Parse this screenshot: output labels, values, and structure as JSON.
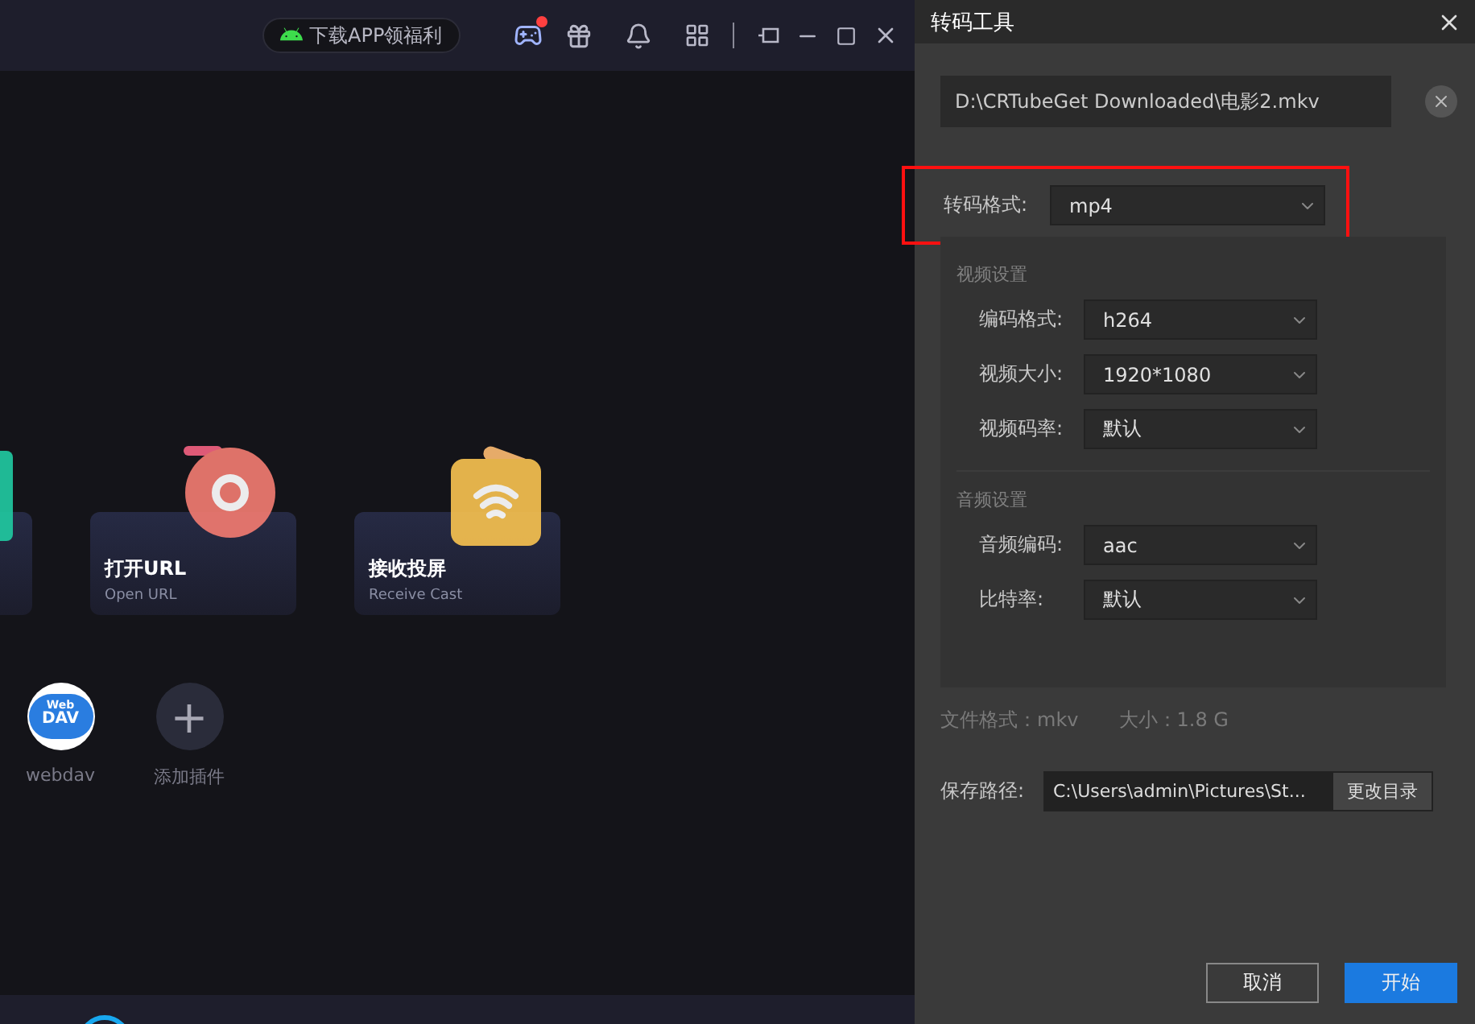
{
  "top_bar": {
    "promo": "下载APP领福利",
    "game_badge": true
  },
  "cards": [
    {
      "kind": "partial"
    },
    {
      "kind": "url",
      "title": "打开URL",
      "subtitle": "Open URL"
    },
    {
      "kind": "cast",
      "title": "接收投屏",
      "subtitle": "Receive Cast"
    }
  ],
  "plugins": [
    {
      "kind": "webdav",
      "label": "webdav",
      "logo": "Web",
      "logo2": "DAV"
    },
    {
      "kind": "add",
      "label": "添加插件",
      "symbol": "+"
    }
  ],
  "dialog": {
    "title": "转码工具",
    "file": "D:\\CRTubeGet Downloaded\\电影2.mkv",
    "format": {
      "label": "转码格式:",
      "value": "mp4",
      "highlighted": true
    },
    "sections": [
      {
        "title": "视频设置",
        "rows": [
          {
            "label": "编码格式:",
            "value": "h264"
          },
          {
            "label": "视频大小:",
            "value": "1920*1080"
          },
          {
            "label": "视频码率:",
            "value": "默认"
          }
        ]
      },
      {
        "title": "音频设置",
        "rows": [
          {
            "label": "音频编码:",
            "value": "aac"
          },
          {
            "label": "比特率:",
            "value": "默认"
          }
        ]
      }
    ],
    "file_format": "文件格式：mkv",
    "file_size": "大小：1.8 G",
    "save_label": "保存路径:",
    "save_path": "C:\\Users\\admin\\Pictures\\St...",
    "change_button": "更改目录",
    "buttons": [
      {
        "kind": "secondary",
        "label": "取消"
      },
      {
        "kind": "primary",
        "label": "开始"
      }
    ]
  }
}
